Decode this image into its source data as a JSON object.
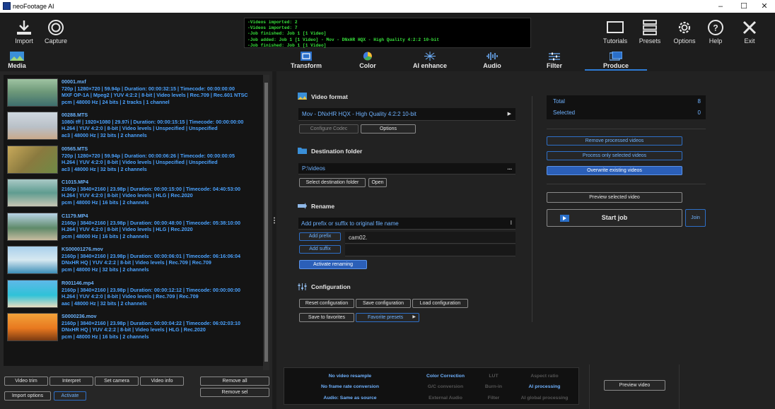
{
  "window": {
    "title": "neoFootage AI",
    "controls": [
      "–",
      "☐",
      "✕"
    ]
  },
  "toolbar": {
    "import": "Import",
    "capture": "Capture",
    "tutorials": "Tutorials",
    "presets": "Presets",
    "options": "Options",
    "help": "Help",
    "exit": "Exit"
  },
  "log": [
    "-Videos imported: 2",
    "-Videos imported: 7",
    "-Job finished: Job 1 [1 Video]",
    "-Job added: Job 1 [1 Video]  -  Mov - DNxHR HQX - High Quality 4:2:2 10-bit",
    "-Job finished: Job 1 [1 Video]"
  ],
  "tabs": {
    "media": "Media",
    "transform": "Transform",
    "color": "Color",
    "ai_enhance": "AI enhance",
    "audio": "Audio",
    "filter": "Filter",
    "produce": "Produce"
  },
  "media": [
    {
      "name": "00001.mxf",
      "l1": "720p | 1280×720 | 59.94p | Duration:  00:00:32:15 | Timecode: 00:00:00:00",
      "l2": "MXF OP-1A | Mpeg2 | YUV 4:2:2 | 8-bit | Video levels | Rec.709 | Rec.601 NTSC",
      "l3": "pcm | 48000 Hz | 24 bits | 2 tracks | 1 channel"
    },
    {
      "name": "00288.MTS",
      "l1": "1080i tff | 1920×1080 | 29.97i | Duration:  00:00:15:15 | Timecode: 00:00:00:00",
      "l2": "H.264 | YUV 4:2:0 | 8-bit | Video levels | Unspecified | Unspecified",
      "l3": "ac3 | 48000 Hz | 32 bits | 2 channels"
    },
    {
      "name": "00565.MTS",
      "l1": "720p | 1280×720 | 59.94p | Duration:  00:00:06:26 | Timecode: 00:00:00:05",
      "l2": "H.264 | YUV 4:2:0 | 8-bit | Video levels | Unspecified | Unspecified",
      "l3": "ac3 | 48000 Hz | 32 bits | 2 channels"
    },
    {
      "name": "C1015.MP4",
      "l1": "2160p | 3840×2160 | 23.98p | Duration:  00:00:15:00 | Timecode: 04:40:53:00",
      "l2": "H.264 | YUV 4:2:0 | 8-bit | Video levels | HLG | Rec.2020",
      "l3": "pcm | 48000 Hz | 16 bits | 2 channels"
    },
    {
      "name": "C1179.MP4",
      "l1": "2160p | 3840×2160 | 23.98p | Duration:  00:00:48:00 | Timecode: 05:38:10:00",
      "l2": "H.264 | YUV 4:2:0 | 8-bit | Video levels | HLG | Rec.2020",
      "l3": "pcm | 48000 Hz | 16 bits | 2 channels"
    },
    {
      "name": "KS00001276.mov",
      "l1": "2160p | 3840×2160 | 23.98p | Duration:  00:00:06:01 | Timecode: 06:16:06:04",
      "l2": "DNxHR HQ | YUV 4:2:2 | 8-bit | Video levels | Rec.709 | Rec.709",
      "l3": "pcm | 48000 Hz | 32 bits | 2 channels"
    },
    {
      "name": "R001146.mp4",
      "l1": "2160p | 3840×2160 | 23.98p | Duration:  00:00:12:12 | Timecode: 00:00:00:00",
      "l2": "H.264 | YUV 4:2:0 | 8-bit | Video levels | Rec.709 | Rec.709",
      "l3": "aac | 48000 Hz | 32 bits | 2 channels"
    },
    {
      "name": "S0000236.mov",
      "l1": "2160p | 3840×2160 | 23.98p | Duration:  00:00:04:22 | Timecode: 06:02:03:10",
      "l2": "DNxHR HQ | YUV 4:2:2 | 8-bit | Video levels | HLG | Rec.2020",
      "l3": "pcm | 48000 Hz | 16 bits | 2 channels"
    }
  ],
  "left_buttons": {
    "video_trim": "Video trim",
    "interpret": "Interpret",
    "set_camera": "Set camera",
    "video_info": "Video info",
    "remove_all": "Remove all",
    "remove_sel": "Remove sel",
    "import_options": "Import options",
    "activate": "Activate"
  },
  "video_format": {
    "title": "Video format",
    "value": "Mov - DNxHR HQX - High Quality 4:2:2 10-bit",
    "configure": "Configure Codec",
    "options": "Options"
  },
  "destination": {
    "title": "Destination folder",
    "path": "P:\\videos",
    "dots": "...",
    "select": "Select destination folder",
    "open": "Open"
  },
  "rename": {
    "title": "Rename",
    "placeholder": "Add prefix or suffix to original file name",
    "add_prefix": "Add prefix",
    "prefix_value": "cam02.",
    "add_suffix": "Add suffix",
    "suffix_value": "",
    "activate": "Activate renaming"
  },
  "configuration": {
    "title": "Configuration",
    "reset": "Reset configuration",
    "save": "Save configuration",
    "load": "Load configuration",
    "save_fav": "Save to favorites",
    "fav_presets": "Favorite presets"
  },
  "summary": {
    "total_label": "Total",
    "total": "8",
    "selected_label": "Selected",
    "selected": "0"
  },
  "actions": {
    "remove_processed": "Remove processed videos",
    "process_selected": "Process only selected videos",
    "overwrite": "Overwrite existing videos",
    "preview_selected": "Preview selected video",
    "start_job": "Start job",
    "join": "Join"
  },
  "bottom_status": {
    "c1": [
      "No video resample",
      "No frame rate conversion",
      "Audio: Same as source"
    ],
    "c2": [
      "Color Correction",
      "G/C conversion",
      "External Audio"
    ],
    "c3": [
      "LUT",
      "Burn-in",
      "Filter"
    ],
    "c4": [
      "Aspect ratio",
      "AI processing",
      "AI global processing"
    ],
    "preview": "Preview video"
  },
  "colors": {
    "accent": "#2e7cd6",
    "log_text": "#37e03b",
    "meta_text": "#4aa2ff"
  }
}
